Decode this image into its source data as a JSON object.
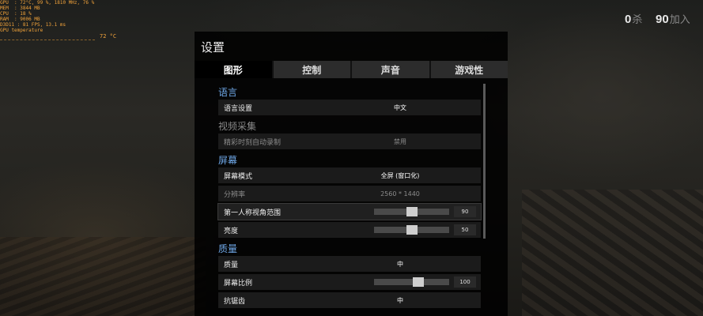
{
  "overlay": {
    "lines": [
      "GPU  : 72°C, 99 %, 1810 MHz, 76 %",
      "MEM  : 3844 MB",
      "CPU  : 18 %",
      "RAM  : 9006 MB",
      "D3D11 : 81 FPS, 13.1 ms",
      "GPU temperature"
    ],
    "temp_value": "72 °C",
    "color": "#f0a23a"
  },
  "hud": {
    "kills_value": "0",
    "kills_label": "杀",
    "alive_value": "90",
    "alive_label": "加入"
  },
  "settings": {
    "title": "设置",
    "tabs": [
      "图形",
      "控制",
      "声音",
      "游戏性"
    ],
    "active_tab": 0,
    "sections": {
      "language": "语言",
      "video_capture": "视频采集",
      "screen": "屏幕",
      "quality": "质量"
    },
    "rows": {
      "language_setting": {
        "label": "语言设置",
        "value": "中文"
      },
      "highlight_record": {
        "label": "精彩时刻自动录制",
        "value": "禁用"
      },
      "screen_mode": {
        "label": "屏幕模式",
        "value": "全屏 (窗口化)"
      },
      "resolution": {
        "label": "分辨率",
        "value": "2560 * 1440"
      },
      "fov": {
        "label": "第一人称视角范围",
        "value": "90",
        "level": 0.5
      },
      "brightness": {
        "label": "亮度",
        "value": "50",
        "level": 0.5
      },
      "quality": {
        "label": "质量",
        "value": "中"
      },
      "screen_scale": {
        "label": "屏幕比例",
        "value": "100",
        "level": 0.6
      },
      "anti_aliasing": {
        "label": "抗锯齿",
        "value": "中"
      }
    },
    "accent_color": "#6fa8e8"
  }
}
